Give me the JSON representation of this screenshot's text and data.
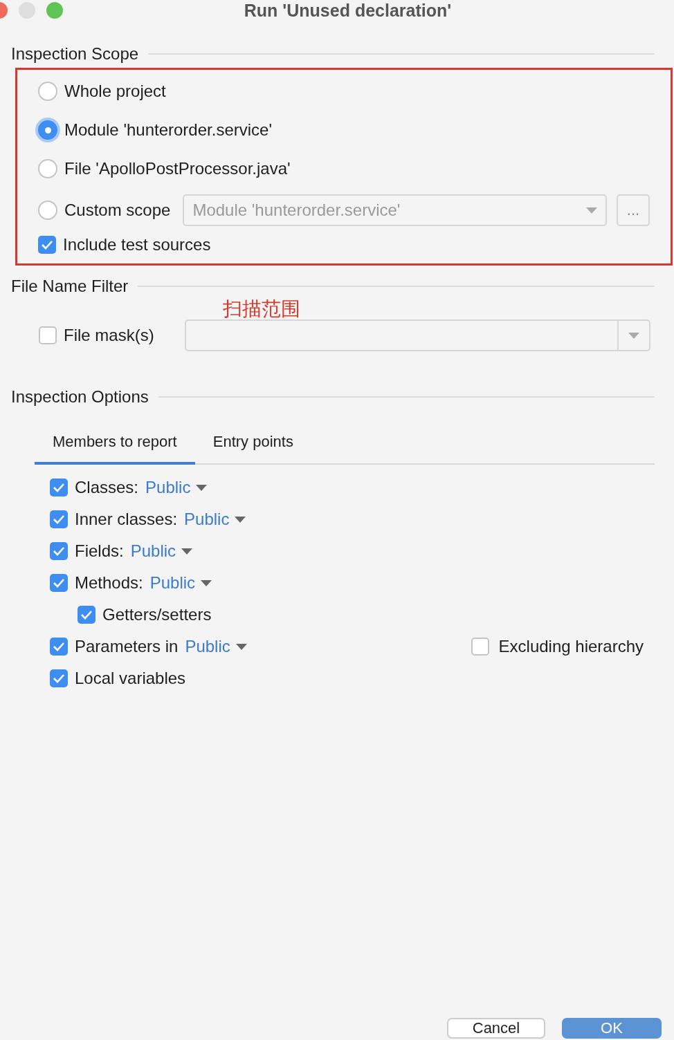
{
  "window": {
    "title": "Run 'Unused declaration'"
  },
  "scope": {
    "title": "Inspection Scope",
    "options": [
      {
        "label": "Whole project",
        "selected": false
      },
      {
        "label": "Module 'hunterorder.service'",
        "selected": true
      },
      {
        "label": "File 'ApolloPostProcessor.java'",
        "selected": false
      },
      {
        "label": "Custom scope",
        "selected": false,
        "dropdown": "Module 'hunterorder.service'",
        "browse": "..."
      }
    ],
    "include_tests": {
      "label": "Include test sources",
      "checked": true
    }
  },
  "file_filter": {
    "title": "File Name Filter",
    "annotation": "扫描范围",
    "mask": {
      "label": "File mask(s)",
      "checked": false
    }
  },
  "options": {
    "title": "Inspection Options",
    "tabs": [
      {
        "label": "Members to report",
        "selected": true
      },
      {
        "label": "Entry points",
        "selected": false
      }
    ],
    "members": [
      {
        "label": "Classes:",
        "value": "Public",
        "checked": true
      },
      {
        "label": "Inner classes:",
        "value": "Public",
        "checked": true
      },
      {
        "label": "Fields:",
        "value": "Public",
        "checked": true
      },
      {
        "label": "Methods:",
        "value": "Public",
        "checked": true,
        "children": [
          {
            "label": "Getters/setters",
            "checked": true
          }
        ]
      },
      {
        "label": "Parameters in",
        "value": "Public",
        "checked": true,
        "extra": {
          "label": "Excluding hierarchy",
          "checked": false
        }
      },
      {
        "label": "Local variables",
        "checked": true
      }
    ]
  },
  "buttons": [
    {
      "label": "Cancel",
      "default": false
    },
    {
      "label": "OK",
      "default": true
    }
  ]
}
